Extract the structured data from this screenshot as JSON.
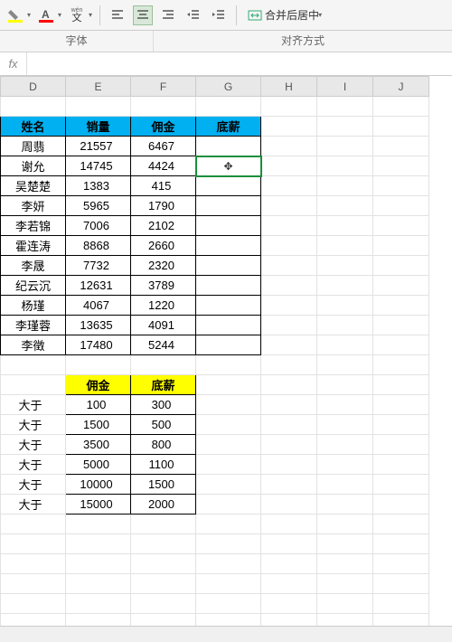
{
  "ribbon": {
    "merge_label": "合并后居中",
    "groups": {
      "font": "字体",
      "align": "对齐方式"
    },
    "wen_label": "wén"
  },
  "fx": {
    "label": "fx",
    "value": ""
  },
  "columns": [
    "D",
    "E",
    "F",
    "G",
    "H",
    "I",
    "J"
  ],
  "main_headers": {
    "name": "姓名",
    "sales": "销量",
    "comm": "佣金",
    "base": "底薪"
  },
  "main_rows": [
    {
      "name": "周翡",
      "sales": "21557",
      "comm": "6467"
    },
    {
      "name": "谢允",
      "sales": "14745",
      "comm": "4424"
    },
    {
      "name": "吴楚楚",
      "sales": "1383",
      "comm": "415"
    },
    {
      "name": "李妍",
      "sales": "5965",
      "comm": "1790"
    },
    {
      "name": "李若锦",
      "sales": "7006",
      "comm": "2102"
    },
    {
      "name": "霍连涛",
      "sales": "8868",
      "comm": "2660"
    },
    {
      "name": "李晟",
      "sales": "7732",
      "comm": "2320"
    },
    {
      "name": "纪云沉",
      "sales": "12631",
      "comm": "3789"
    },
    {
      "name": "杨瑾",
      "sales": "4067",
      "comm": "1220"
    },
    {
      "name": "李瑾蓉",
      "sales": "13635",
      "comm": "4091"
    },
    {
      "name": "李徵",
      "sales": "17480",
      "comm": "5244"
    }
  ],
  "lookup_headers": {
    "comm": "佣金",
    "base": "底薪"
  },
  "lookup_label": "大于",
  "lookup_rows": [
    {
      "comm": "100",
      "base": "300"
    },
    {
      "comm": "1500",
      "base": "500"
    },
    {
      "comm": "3500",
      "base": "800"
    },
    {
      "comm": "5000",
      "base": "1100"
    },
    {
      "comm": "10000",
      "base": "1500"
    },
    {
      "comm": "15000",
      "base": "2000"
    }
  ]
}
